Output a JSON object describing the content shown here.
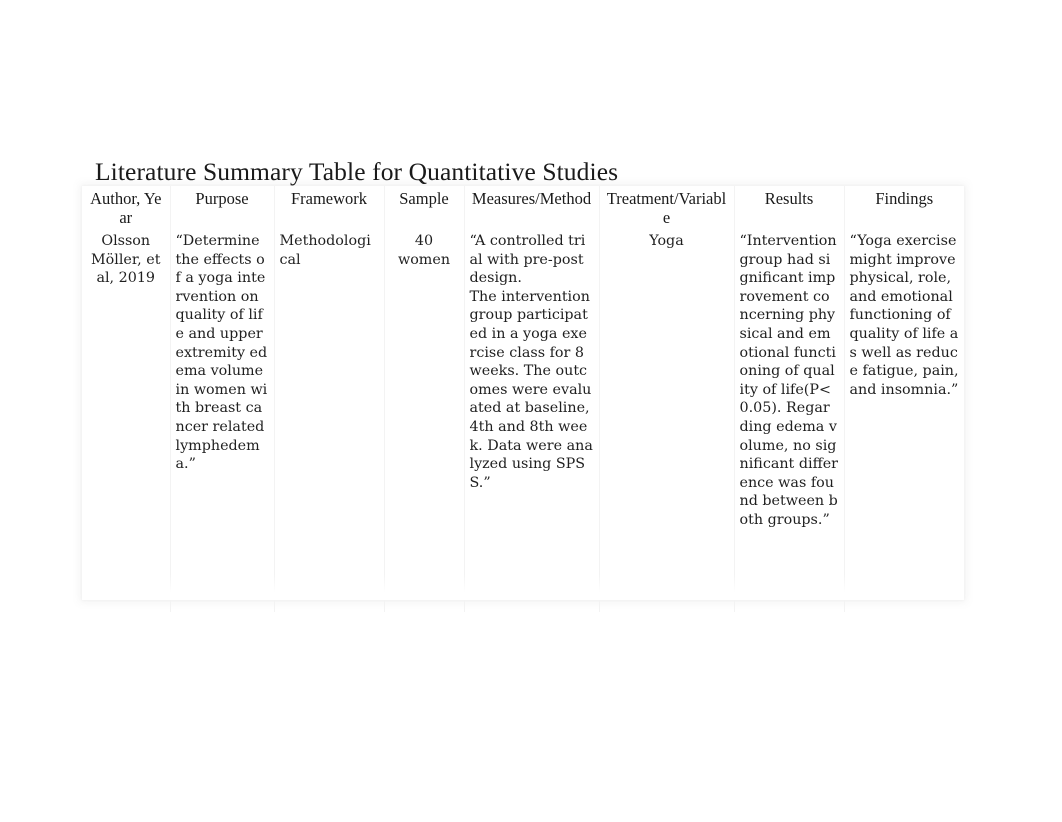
{
  "document": {
    "title": "Literature Summary Table for Quantitative Studies"
  },
  "table": {
    "headers": [
      "Author, Year",
      "Purpose",
      "Framework",
      "Sample",
      "Measures/Method",
      "Treatment/Variable",
      "Results",
      "Findings"
    ],
    "rows": [
      {
        "author_year": "Olsson Möller, et al, 2019",
        "purpose": "“Determine the effects of a yoga intervention on quality of life and upper extremity edema volume in women with breast cancer related lymphedema.”",
        "framework": "Methodological",
        "sample": "40 women",
        "measures_method": "“A controlled trial with pre-post design.\nThe intervention group participated in a yoga exercise class for 8 weeks. The outcomes were evaluated at baseline, 4th and 8th week. Data were analyzed using SPSS.”",
        "treatment_variable": "Yoga",
        "results": "“Intervention group had significant improvement concerning physical and emotional functioning of quality of life(P<0.05). Regarding edema volume, no significant difference was found between both groups.”",
        "findings": "“Yoga exercise might improve physical, role, and emotional functioning of quality of life as well as reduce fatigue, pain, and insomnia.”"
      }
    ]
  },
  "colors": {
    "page_background": "#ffffff",
    "text": "#1a1a1a",
    "cell_divider": "#f3f3f3"
  }
}
